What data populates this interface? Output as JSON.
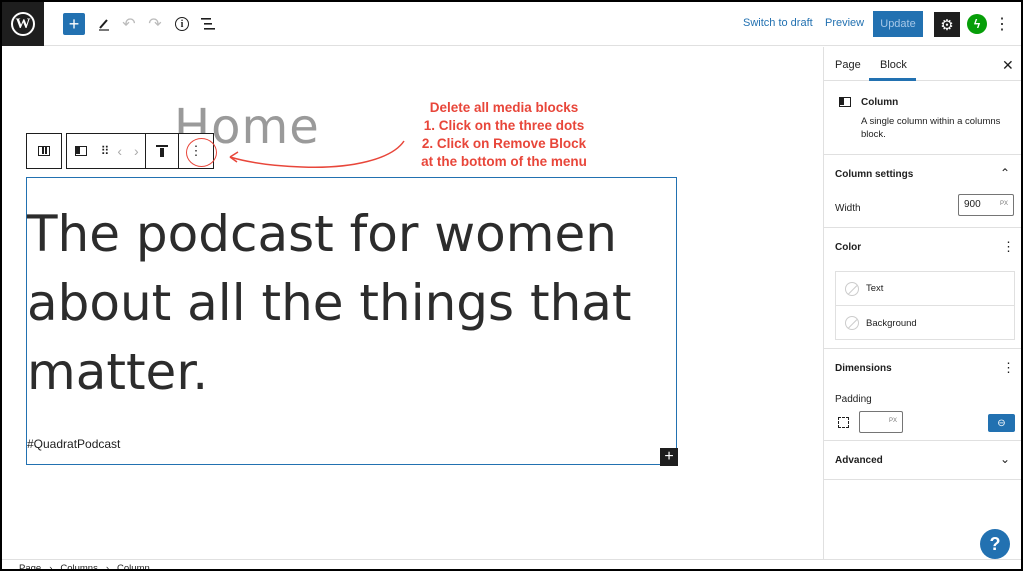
{
  "topbar": {
    "add_icon": "plus-icon",
    "tools_icon": "pencil-icon",
    "undo_icon": "undo-icon",
    "redo_icon": "redo-icon",
    "details_icon": "info-icon",
    "list_view_icon": "list-view-icon",
    "switch_to_draft": "Switch to draft",
    "preview": "Preview",
    "update": "Update",
    "settings_icon": "gear-icon",
    "jetpack_icon": "jetpack-icon",
    "options_icon": "kebab-icon"
  },
  "editor": {
    "page_title": "Home",
    "heading": "The podcast for women about all the things that matter.",
    "hashtag": "#QuadratPodcast"
  },
  "annotation": {
    "line1": "Delete all media blocks",
    "line2": "1. Click on the three dots",
    "line3": "2. Click on Remove Block",
    "line4": "at the bottom of the menu",
    "color": "#e8463a"
  },
  "sidebar": {
    "tab_page": "Page",
    "tab_block": "Block",
    "block_card": {
      "title": "Column",
      "description": "A single column within a columns block."
    },
    "column_settings": {
      "title": "Column settings",
      "width_label": "Width",
      "width_value": "900",
      "width_unit": "PX"
    },
    "color": {
      "title": "Color",
      "text": "Text",
      "background": "Background"
    },
    "dimensions": {
      "title": "Dimensions",
      "padding_label": "Padding",
      "padding_unit": "PX"
    },
    "advanced": {
      "title": "Advanced"
    },
    "help": "?"
  },
  "breadcrumb": [
    "Page",
    "Columns",
    "Column"
  ],
  "colors": {
    "accent": "#2271b1",
    "dark": "#1e1e1e",
    "jetpack": "#069e08"
  }
}
